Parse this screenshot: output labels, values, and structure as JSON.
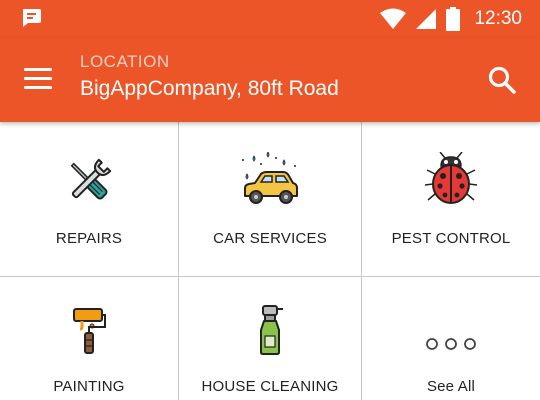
{
  "status_bar": {
    "time": "12:30",
    "icons": [
      "notification-icon",
      "wifi-icon",
      "signal-icon",
      "battery-icon"
    ]
  },
  "app_bar": {
    "location_label": "LOCATION",
    "location_value": "BigAppCompany, 80ft Road",
    "icons": [
      "menu-icon",
      "search-icon"
    ]
  },
  "categories": [
    {
      "label": "REPAIRS",
      "icon": "wrench-screwdriver-icon"
    },
    {
      "label": "CAR SERVICES",
      "icon": "car-wash-icon"
    },
    {
      "label": "PEST CONTROL",
      "icon": "ladybug-icon"
    },
    {
      "label": "PAINTING",
      "icon": "paint-roller-icon"
    },
    {
      "label": "HOUSE CLEANING",
      "icon": "spray-bottle-icon"
    },
    {
      "label": "See All",
      "icon": "more-dots-icon"
    }
  ],
  "colors": {
    "primary": "#ec5528",
    "divider": "#c9c9c9",
    "text": "#222222"
  }
}
